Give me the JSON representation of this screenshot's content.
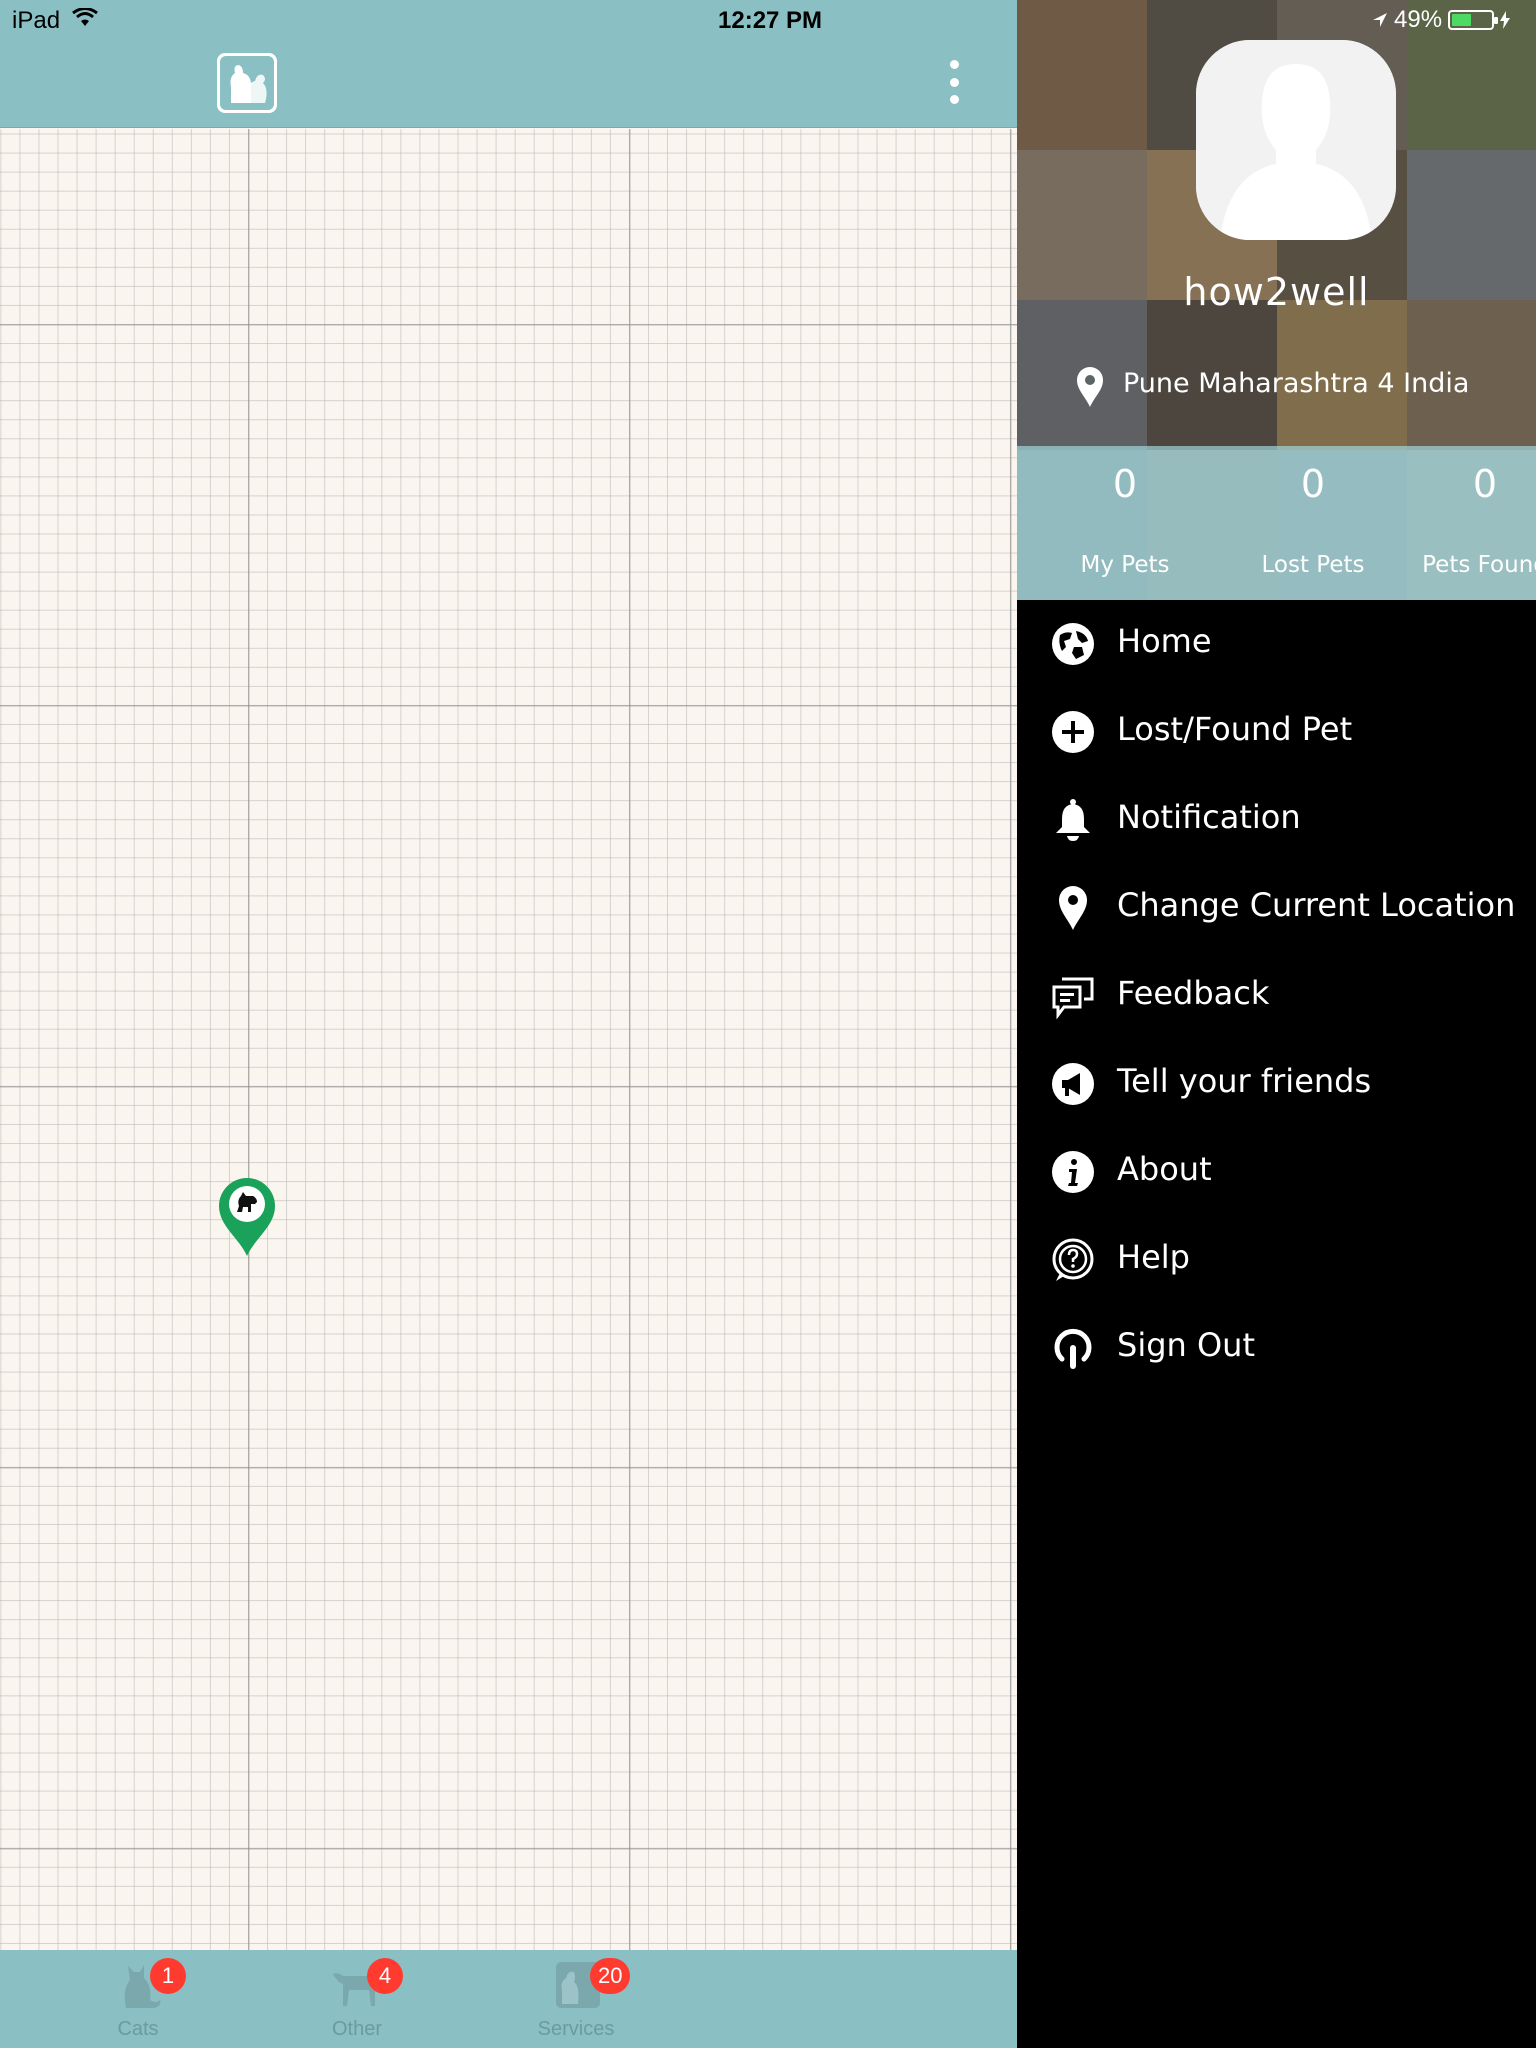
{
  "status_bar": {
    "device": "iPad",
    "time": "12:27 PM",
    "battery_percent": "49%",
    "battery_level": 0.49
  },
  "app": {
    "logo_icon": "pets-logo-icon",
    "overflow_icon": "more-vertical-icon",
    "colors": {
      "accent": "#8abfc3",
      "marker": "#1aa15a",
      "badge": "#ff3b30"
    }
  },
  "map": {
    "marker_icon": "dog-marker-icon",
    "locate_icon": "navigation-arrow-icon"
  },
  "tabs": [
    {
      "label": "Cats",
      "badge": "1",
      "icon": "cat-icon"
    },
    {
      "label": "Other",
      "badge": "4",
      "icon": "horse-icon"
    },
    {
      "label": "Services",
      "badge": "20",
      "icon": "services-icon"
    }
  ],
  "drawer": {
    "username": "how2well",
    "location": "Pune Maharashtra 4 India",
    "stats": [
      {
        "value": "0",
        "label": "My Pets"
      },
      {
        "value": "0",
        "label": "Lost Pets"
      },
      {
        "value": "0",
        "label": "Pets Found"
      }
    ],
    "menu": [
      {
        "label": "Home",
        "icon": "globe-icon"
      },
      {
        "label": "Lost/Found Pet",
        "icon": "plus-circle-icon"
      },
      {
        "label": "Notification",
        "icon": "bell-icon"
      },
      {
        "label": "Change Current Location",
        "icon": "location-pin-icon"
      },
      {
        "label": "Feedback",
        "icon": "chat-icon"
      },
      {
        "label": "Tell your friends",
        "icon": "megaphone-icon"
      },
      {
        "label": "About",
        "icon": "info-icon"
      },
      {
        "label": "Help",
        "icon": "help-icon"
      },
      {
        "label": "Sign Out",
        "icon": "sign-out-icon"
      }
    ]
  }
}
